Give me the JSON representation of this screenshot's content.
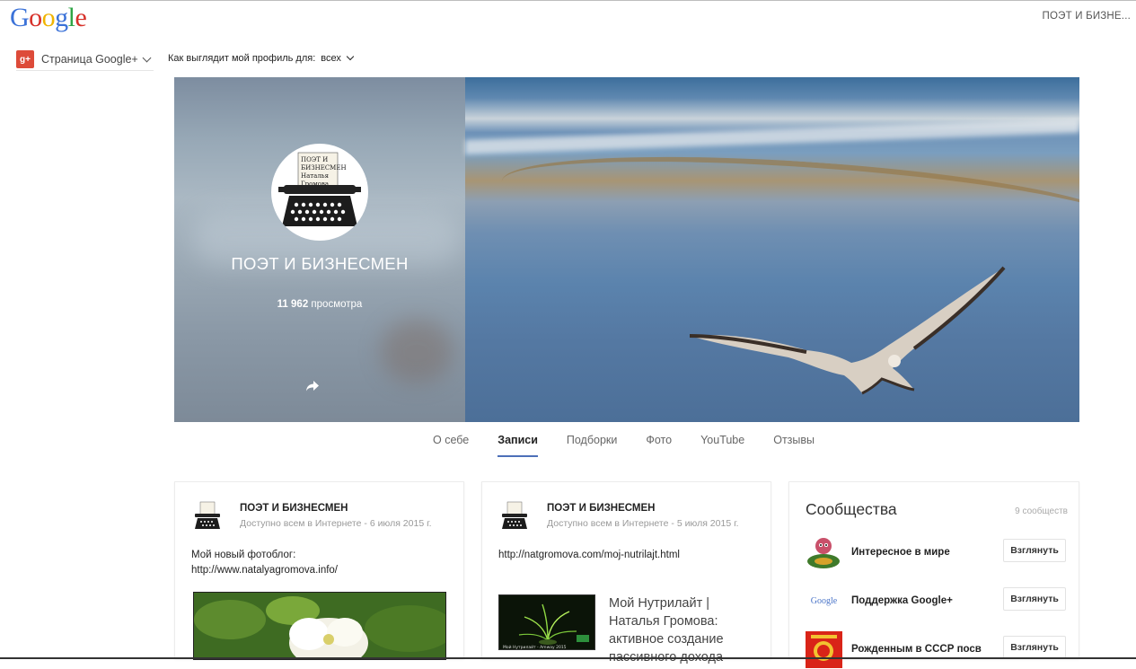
{
  "header": {
    "logo_letters": [
      {
        "ch": "G",
        "color": "#3b72d8"
      },
      {
        "ch": "o",
        "color": "#d7312a"
      },
      {
        "ch": "o",
        "color": "#f0b400"
      },
      {
        "ch": "g",
        "color": "#3b72d8"
      },
      {
        "ch": "l",
        "color": "#2ea445"
      },
      {
        "ch": "e",
        "color": "#d7312a"
      }
    ],
    "user_name": "ПОЭТ И БИЗНЕ..."
  },
  "toolbar": {
    "gplus_badge": "g+",
    "gplus_page_label": "Страница Google+",
    "view_as_label": "Как выглядит мой профиль для:",
    "view_as_value": "всех"
  },
  "profile": {
    "avatar_text": [
      "ПОЭТ И",
      "БИЗНЕСМЕН",
      "Наталья",
      "Громова"
    ],
    "name": "ПОЭТ И БИЗНЕСМЕН",
    "views_count": "11 962",
    "views_label": "просмотра"
  },
  "tabs": [
    {
      "label": "О себе",
      "active": false
    },
    {
      "label": "Записи",
      "active": true
    },
    {
      "label": "Подборки",
      "active": false
    },
    {
      "label": "Фото",
      "active": false
    },
    {
      "label": "YouTube",
      "active": false
    },
    {
      "label": "Отзывы",
      "active": false
    }
  ],
  "posts": [
    {
      "author": "ПОЭТ И БИЗНЕСМЕН",
      "visibility": "Доступно всем в Интернете",
      "date": "6 июля 2015 г.",
      "text_line1": "Мой новый фотоблог:",
      "text_line2": "http://www.natalyagromova.info/"
    },
    {
      "author": "ПОЭТ И БИЗНЕСМЕН",
      "visibility": "Доступно всем в Интернете",
      "date": "5 июля 2015 г.",
      "text_line1": "http://natgromova.com/moj-nutrilajt.html",
      "link_title_lines": [
        "Мой Нутрилайт |",
        "Наталья Громова:",
        "активное создание",
        "пассивного дохода"
      ],
      "link_thumb_caption": "Мой Нутрилайт - Amway 2015"
    }
  ],
  "communities": {
    "title": "Сообщества",
    "count": "9 сообществ",
    "items": [
      {
        "name": "Интересное в мире",
        "button": "Взглянуть",
        "icon": "globe-character-icon"
      },
      {
        "name": "Поддержка Google+",
        "button": "Взглянуть",
        "icon": "google-logo-icon",
        "icon_text": "Google"
      },
      {
        "name": "Рожденным в СССР посв",
        "button": "Взглянуть",
        "icon": "ussr-emblem-icon"
      }
    ]
  },
  "colors": {
    "accent_tab": "#4d70b8",
    "gplus_red": "#dd4b39"
  }
}
